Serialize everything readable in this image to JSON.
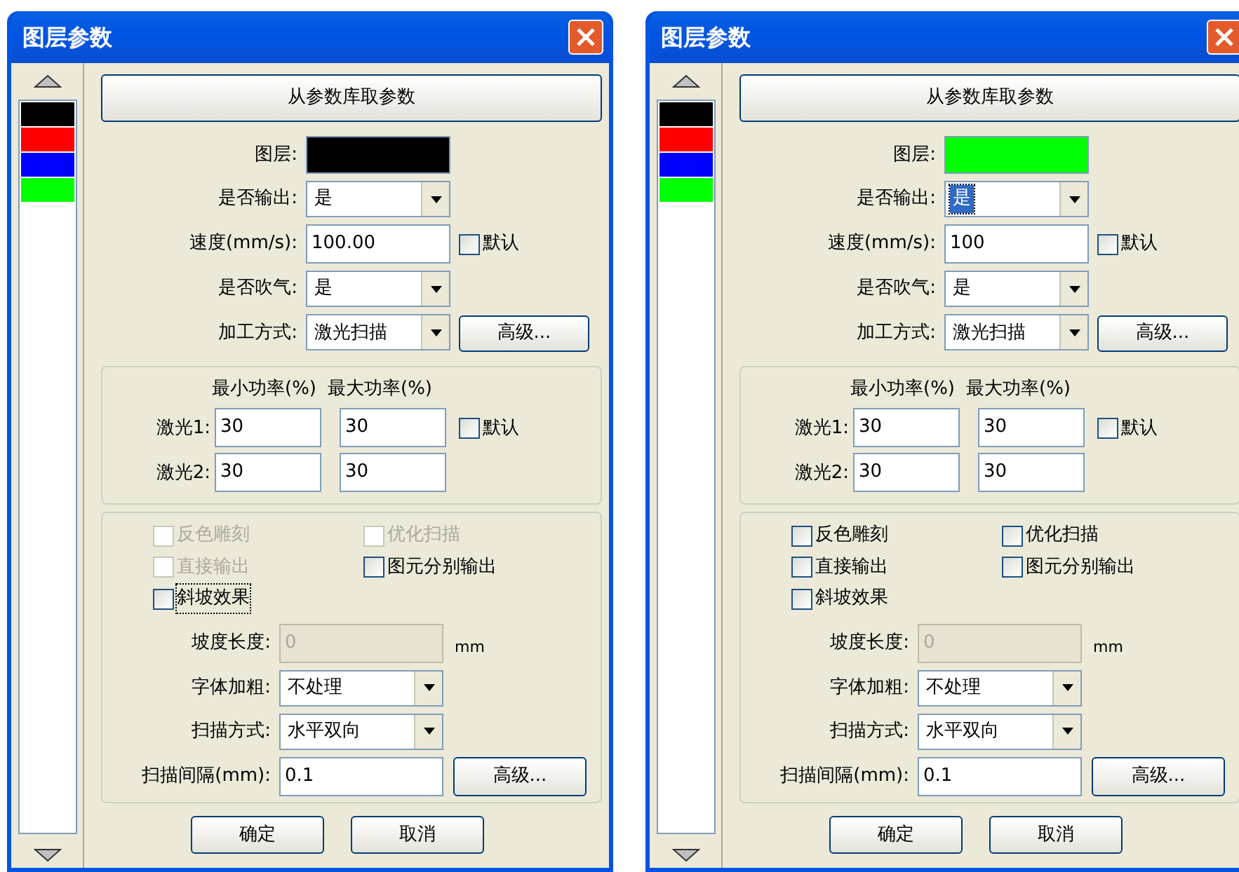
{
  "dialogs": [
    {
      "title": "图层参数",
      "layers": [
        {
          "color": "#000000"
        },
        {
          "color": "#ff0000"
        },
        {
          "color": "#0000ff"
        },
        {
          "color": "#00ff00"
        }
      ],
      "library_button": "从参数库取参数",
      "rows": [
        {
          "kind": "color",
          "label": "图层:",
          "color": "#000000"
        },
        {
          "kind": "select",
          "label": "是否输出:",
          "value": "是",
          "highlighted": false
        },
        {
          "kind": "input",
          "label": "速度(mm/s):",
          "value": "100.00",
          "checkbox": {
            "label": "默认",
            "checked": false
          }
        },
        {
          "kind": "select",
          "label": "是否吹气:",
          "value": "是",
          "highlighted": false
        },
        {
          "kind": "select",
          "label": "加工方式:",
          "value": "激光扫描",
          "highlighted": false,
          "button": "高级..."
        }
      ],
      "power": {
        "headers": [
          "最小功率(%)",
          "最大功率(%)"
        ],
        "rows": [
          {
            "label": "激光1:",
            "min": "30",
            "max": "30",
            "checkbox": {
              "label": "默认",
              "checked": false
            }
          },
          {
            "label": "激光2:",
            "min": "30",
            "max": "30"
          }
        ]
      },
      "options": [
        {
          "label": "反色雕刻",
          "checked": false,
          "disabled": true,
          "focused": false
        },
        {
          "label": "优化扫描",
          "checked": false,
          "disabled": true,
          "focused": false
        },
        {
          "label": "直接输出",
          "checked": false,
          "disabled": true,
          "focused": false
        },
        {
          "label": "图元分别输出",
          "checked": false,
          "disabled": false,
          "focused": false
        },
        {
          "label": "斜坡效果",
          "checked": false,
          "disabled": false,
          "focused": true
        }
      ],
      "scan_rows": [
        {
          "kind": "input",
          "label": "坡度长度:",
          "value": "0",
          "disabled": true,
          "unit": "mm"
        },
        {
          "kind": "select",
          "label": "字体加粗:",
          "value": "不处理"
        },
        {
          "kind": "select",
          "label": "扫描方式:",
          "value": "水平双向"
        },
        {
          "kind": "input",
          "label": "扫描间隔(mm):",
          "value": "0.1",
          "disabled": false,
          "button": "高级..."
        }
      ],
      "buttons": [
        "确定",
        "取消"
      ]
    },
    {
      "title": "图层参数",
      "layers": [
        {
          "color": "#000000"
        },
        {
          "color": "#ff0000"
        },
        {
          "color": "#0000ff"
        },
        {
          "color": "#00ff00"
        }
      ],
      "library_button": "从参数库取参数",
      "rows": [
        {
          "kind": "color",
          "label": "图层:",
          "color": "#00ff00"
        },
        {
          "kind": "select",
          "label": "是否输出:",
          "value": "是",
          "highlighted": true
        },
        {
          "kind": "input",
          "label": "速度(mm/s):",
          "value": "100",
          "checkbox": {
            "label": "默认",
            "checked": false
          }
        },
        {
          "kind": "select",
          "label": "是否吹气:",
          "value": "是",
          "highlighted": false
        },
        {
          "kind": "select",
          "label": "加工方式:",
          "value": "激光扫描",
          "highlighted": false,
          "button": "高级..."
        }
      ],
      "power": {
        "headers": [
          "最小功率(%)",
          "最大功率(%)"
        ],
        "rows": [
          {
            "label": "激光1:",
            "min": "30",
            "max": "30",
            "checkbox": {
              "label": "默认",
              "checked": false
            }
          },
          {
            "label": "激光2:",
            "min": "30",
            "max": "30"
          }
        ]
      },
      "options": [
        {
          "label": "反色雕刻",
          "checked": false,
          "disabled": false,
          "focused": false
        },
        {
          "label": "优化扫描",
          "checked": false,
          "disabled": false,
          "focused": false
        },
        {
          "label": "直接输出",
          "checked": false,
          "disabled": false,
          "focused": false
        },
        {
          "label": "图元分别输出",
          "checked": false,
          "disabled": false,
          "focused": false
        },
        {
          "label": "斜坡效果",
          "checked": false,
          "disabled": false,
          "focused": false
        }
      ],
      "scan_rows": [
        {
          "kind": "input",
          "label": "坡度长度:",
          "value": "0",
          "disabled": true,
          "unit": "mm"
        },
        {
          "kind": "select",
          "label": "字体加粗:",
          "value": "不处理"
        },
        {
          "kind": "select",
          "label": "扫描方式:",
          "value": "水平双向"
        },
        {
          "kind": "input",
          "label": "扫描间隔(mm):",
          "value": "0.1",
          "disabled": false,
          "button": "高级..."
        }
      ],
      "buttons": [
        "确定",
        "取消"
      ]
    }
  ]
}
